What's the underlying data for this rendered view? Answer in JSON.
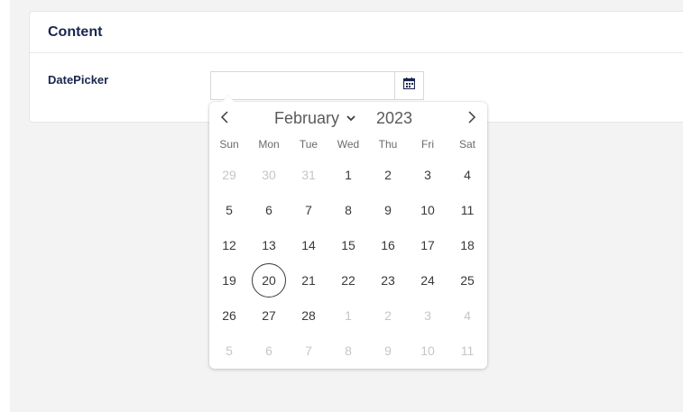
{
  "panel": {
    "title": "Content"
  },
  "field": {
    "label": "DatePicker",
    "value": ""
  },
  "icons": {
    "calendar": "calendar-icon",
    "prev": "chevron-left-icon",
    "next": "chevron-right-icon",
    "month_dropdown": "chevron-down-icon"
  },
  "calendar": {
    "month": "February",
    "year": "2023",
    "weekdays": [
      "Sun",
      "Mon",
      "Tue",
      "Wed",
      "Thu",
      "Fri",
      "Sat"
    ],
    "weeks": [
      [
        {
          "d": "29",
          "m": true
        },
        {
          "d": "30",
          "m": true
        },
        {
          "d": "31",
          "m": true
        },
        {
          "d": "1"
        },
        {
          "d": "2"
        },
        {
          "d": "3"
        },
        {
          "d": "4"
        }
      ],
      [
        {
          "d": "5"
        },
        {
          "d": "6"
        },
        {
          "d": "7"
        },
        {
          "d": "8"
        },
        {
          "d": "9"
        },
        {
          "d": "10"
        },
        {
          "d": "11"
        }
      ],
      [
        {
          "d": "12"
        },
        {
          "d": "13"
        },
        {
          "d": "14"
        },
        {
          "d": "15"
        },
        {
          "d": "16"
        },
        {
          "d": "17"
        },
        {
          "d": "18"
        }
      ],
      [
        {
          "d": "19"
        },
        {
          "d": "20",
          "today": true
        },
        {
          "d": "21"
        },
        {
          "d": "22"
        },
        {
          "d": "23"
        },
        {
          "d": "24"
        },
        {
          "d": "25"
        }
      ],
      [
        {
          "d": "26"
        },
        {
          "d": "27"
        },
        {
          "d": "28"
        },
        {
          "d": "1",
          "m": true
        },
        {
          "d": "2",
          "m": true
        },
        {
          "d": "3",
          "m": true
        },
        {
          "d": "4",
          "m": true
        }
      ],
      [
        {
          "d": "5",
          "m": true
        },
        {
          "d": "6",
          "m": true
        },
        {
          "d": "7",
          "m": true
        },
        {
          "d": "8",
          "m": true
        },
        {
          "d": "9",
          "m": true
        },
        {
          "d": "10",
          "m": true
        },
        {
          "d": "11",
          "m": true
        }
      ]
    ]
  },
  "colors": {
    "title": "#1b264f",
    "calendar_icon": "#1b264f",
    "day_text": "#393939",
    "muted_day": "#c6c6c6",
    "background": "#f4f3f4"
  }
}
